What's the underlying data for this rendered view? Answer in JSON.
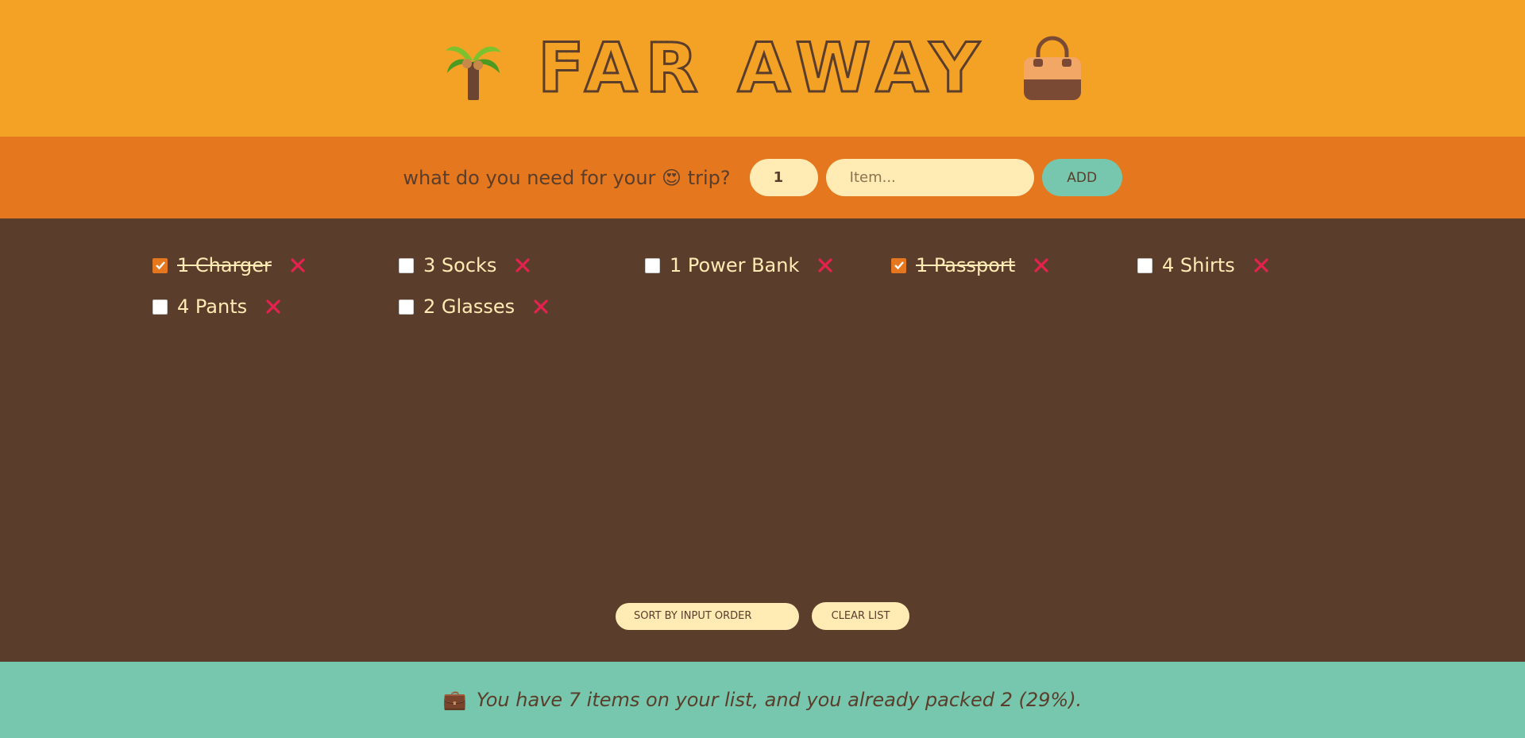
{
  "header": {
    "title": "FAR AWAY",
    "left_icon": "palm-tree-icon",
    "right_icon": "travel-bag-icon"
  },
  "form": {
    "prompt_before": "what do you need for your",
    "prompt_emoji": "😍",
    "prompt_after": "trip?",
    "quantity_value": "1",
    "item_placeholder": "Item...",
    "add_label": "ADD"
  },
  "items": [
    {
      "quantity": 1,
      "description": "Charger",
      "label": "1 Charger",
      "packed": true
    },
    {
      "quantity": 3,
      "description": "Socks",
      "label": "3 Socks",
      "packed": false
    },
    {
      "quantity": 1,
      "description": "Power Bank",
      "label": "1 Power Bank",
      "packed": false
    },
    {
      "quantity": 1,
      "description": "Passport",
      "label": "1 Passport",
      "packed": true
    },
    {
      "quantity": 4,
      "description": "Shirts",
      "label": "4 Shirts",
      "packed": false
    },
    {
      "quantity": 4,
      "description": "Pants",
      "label": "4 Pants",
      "packed": false
    },
    {
      "quantity": 2,
      "description": "Glasses",
      "label": "2 Glasses",
      "packed": false
    }
  ],
  "actions": {
    "sort_selected": "SORT BY INPUT ORDER",
    "clear_label": "CLEAR LIST"
  },
  "stats": {
    "emoji": "💼",
    "text": "You have 7 items on your list, and you already packed 2 (29%)."
  },
  "colors": {
    "header_bg": "#f4a226",
    "form_bg": "#e5771f",
    "list_bg": "#5a3e2b",
    "stats_bg": "#76c7ad",
    "cream": "#ffebb3",
    "delete_red": "#e5214f"
  }
}
